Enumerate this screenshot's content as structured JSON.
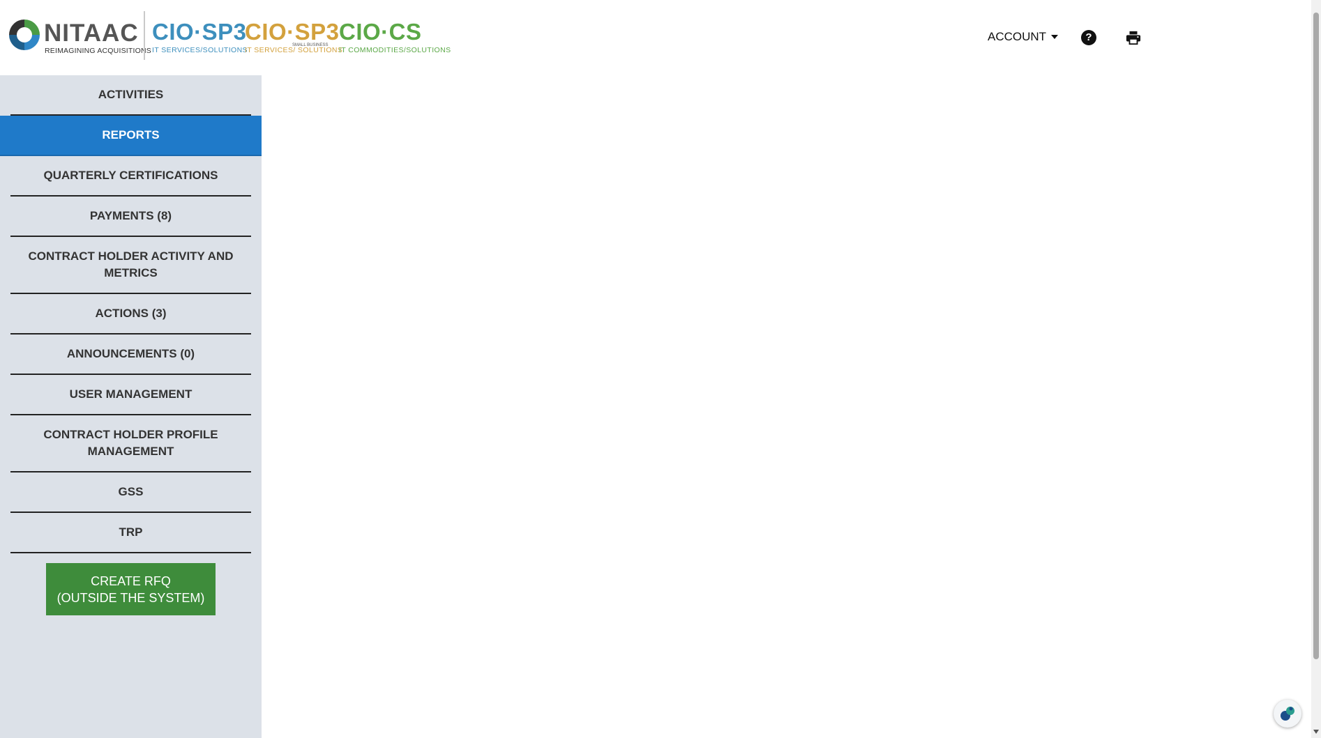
{
  "header": {
    "logo": {
      "name": "NITAAC",
      "tagline": "REIMAGINING ACQUISITIONS"
    },
    "brands": [
      {
        "mark": "CIO·SP3",
        "sub": "IT SERVICES/SOLUTIONS",
        "color": "#3d8fbd"
      },
      {
        "mark": "CIO·SP3",
        "tiny": "SMALL BUSINESS",
        "sub": "IT SERVICES/ SOLUTIONS",
        "color": "#d3a13d"
      },
      {
        "mark": "CIO·CS",
        "sub": "IT COMMODITIES/SOLUTIONS",
        "color": "#5ba847"
      }
    ],
    "account_label": "ACCOUNT",
    "help_glyph": "?"
  },
  "sidebar": {
    "active_color": "#1f7ac9",
    "items": [
      {
        "label": "ACTIVITIES"
      },
      {
        "label": "REPORTS",
        "active": true
      },
      {
        "label": "QUARTERLY CERTIFICATIONS"
      },
      {
        "label": "PAYMENTS (8)"
      },
      {
        "label": "CONTRACT HOLDER ACTIVITY AND METRICS"
      },
      {
        "label": "ACTIONS (3)"
      },
      {
        "label": "ANNOUNCEMENTS (0)"
      },
      {
        "label": "USER MANAGEMENT"
      },
      {
        "label": "CONTRACT HOLDER PROFILE MANAGEMENT"
      },
      {
        "label": "GSS"
      },
      {
        "label": "TRP"
      }
    ],
    "create_rfq_label": "CREATE RFQ\n(OUTSIDE THE SYSTEM)",
    "create_rfq_color": "#3e8c3b"
  }
}
